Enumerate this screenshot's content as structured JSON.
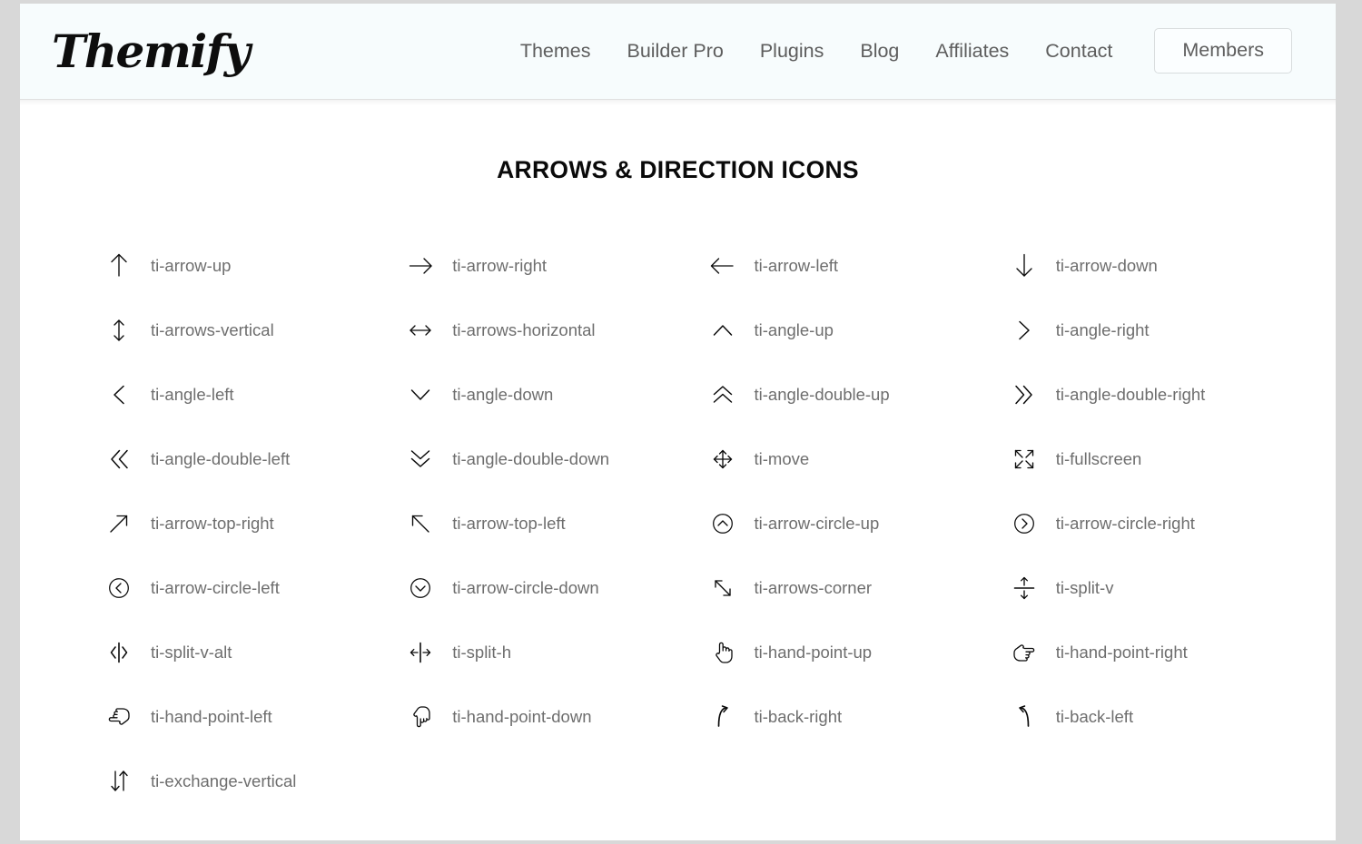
{
  "header": {
    "logo_text": "Themify",
    "nav_items": [
      {
        "label": "Themes",
        "name": "nav-themes"
      },
      {
        "label": "Builder Pro",
        "name": "nav-builder-pro"
      },
      {
        "label": "Plugins",
        "name": "nav-plugins"
      },
      {
        "label": "Blog",
        "name": "nav-blog"
      },
      {
        "label": "Affiliates",
        "name": "nav-affiliates"
      },
      {
        "label": "Contact",
        "name": "nav-contact"
      }
    ],
    "members_button": "Members"
  },
  "main": {
    "title": "ARROWS & DIRECTION ICONS",
    "icons": [
      {
        "label": "ti-arrow-up",
        "icon": "arrow-up-icon"
      },
      {
        "label": "ti-arrow-right",
        "icon": "arrow-right-icon"
      },
      {
        "label": "ti-arrow-left",
        "icon": "arrow-left-icon"
      },
      {
        "label": "ti-arrow-down",
        "icon": "arrow-down-icon"
      },
      {
        "label": "ti-arrows-vertical",
        "icon": "arrows-vertical-icon"
      },
      {
        "label": "ti-arrows-horizontal",
        "icon": "arrows-horizontal-icon"
      },
      {
        "label": "ti-angle-up",
        "icon": "angle-up-icon"
      },
      {
        "label": "ti-angle-right",
        "icon": "angle-right-icon"
      },
      {
        "label": "ti-angle-left",
        "icon": "angle-left-icon"
      },
      {
        "label": "ti-angle-down",
        "icon": "angle-down-icon"
      },
      {
        "label": "ti-angle-double-up",
        "icon": "angle-double-up-icon"
      },
      {
        "label": "ti-angle-double-right",
        "icon": "angle-double-right-icon"
      },
      {
        "label": "ti-angle-double-left",
        "icon": "angle-double-left-icon"
      },
      {
        "label": "ti-angle-double-down",
        "icon": "angle-double-down-icon"
      },
      {
        "label": "ti-move",
        "icon": "move-icon"
      },
      {
        "label": "ti-fullscreen",
        "icon": "fullscreen-icon"
      },
      {
        "label": "ti-arrow-top-right",
        "icon": "arrow-top-right-icon"
      },
      {
        "label": "ti-arrow-top-left",
        "icon": "arrow-top-left-icon"
      },
      {
        "label": "ti-arrow-circle-up",
        "icon": "arrow-circle-up-icon"
      },
      {
        "label": "ti-arrow-circle-right",
        "icon": "arrow-circle-right-icon"
      },
      {
        "label": "ti-arrow-circle-left",
        "icon": "arrow-circle-left-icon"
      },
      {
        "label": "ti-arrow-circle-down",
        "icon": "arrow-circle-down-icon"
      },
      {
        "label": "ti-arrows-corner",
        "icon": "arrows-corner-icon"
      },
      {
        "label": "ti-split-v",
        "icon": "split-v-icon"
      },
      {
        "label": "ti-split-v-alt",
        "icon": "split-v-alt-icon"
      },
      {
        "label": "ti-split-h",
        "icon": "split-h-icon"
      },
      {
        "label": "ti-hand-point-up",
        "icon": "hand-point-up-icon"
      },
      {
        "label": "ti-hand-point-right",
        "icon": "hand-point-right-icon"
      },
      {
        "label": "ti-hand-point-left",
        "icon": "hand-point-left-icon"
      },
      {
        "label": "ti-hand-point-down",
        "icon": "hand-point-down-icon"
      },
      {
        "label": "ti-back-right",
        "icon": "back-right-icon"
      },
      {
        "label": "ti-back-left",
        "icon": "back-left-icon"
      },
      {
        "label": "ti-exchange-vertical",
        "icon": "exchange-vertical-icon"
      }
    ]
  },
  "colors": {
    "header_bg": "#f7fcfd",
    "page_bg": "#ffffff",
    "nav_text": "#5d5d5d",
    "label_text": "#6e6e6e",
    "icon_stroke": "#0b0b0b",
    "title_text": "#0a0a0a",
    "button_border": "#d8dcdd"
  }
}
